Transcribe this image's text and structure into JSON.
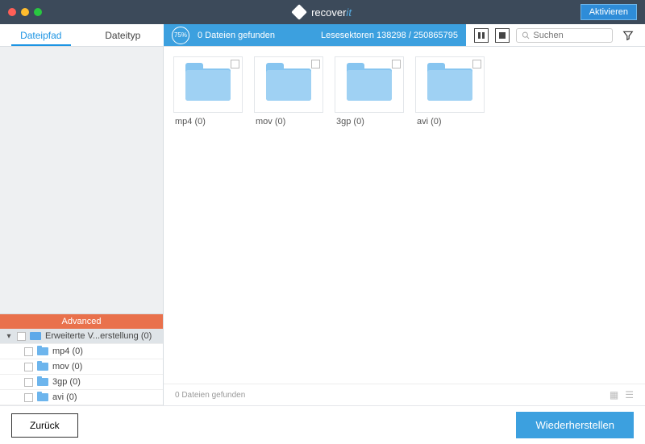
{
  "title": {
    "brand1": "recover",
    "brand2": "it"
  },
  "activate": "Aktivieren",
  "tabs": {
    "filepath": "Dateipfad",
    "filetype": "Dateityp"
  },
  "progress": {
    "percent": "75%",
    "found": "0 Dateien gefunden",
    "sectors": "Lesesektoren 138298 / 250865795"
  },
  "search": {
    "placeholder": "Suchen"
  },
  "sidebar": {
    "advanced": "Advanced",
    "root": "Erweiterte V...erstellung (0)",
    "children": [
      {
        "name": "mp4 (0)"
      },
      {
        "name": "mov (0)"
      },
      {
        "name": "3gp (0)"
      },
      {
        "name": "avi (0)"
      }
    ]
  },
  "folders": [
    {
      "name": "mp4 (0)"
    },
    {
      "name": "mov (0)"
    },
    {
      "name": "3gp (0)"
    },
    {
      "name": "avi (0)"
    }
  ],
  "status": "0 Dateien gefunden",
  "footer": {
    "back": "Zurück",
    "recover": "Wiederherstellen"
  }
}
